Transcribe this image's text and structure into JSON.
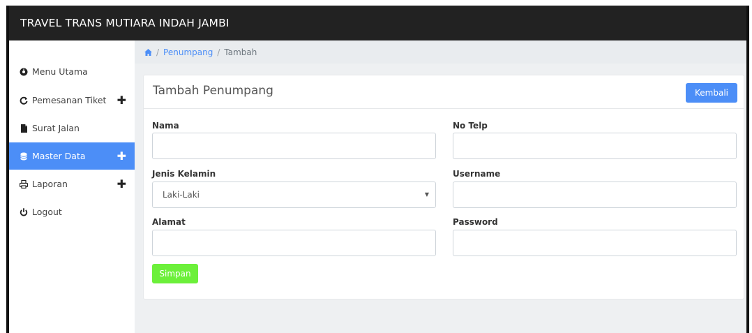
{
  "app": {
    "title": "TRAVEL TRANS MUTIARA INDAH JAMBI"
  },
  "sidebar": {
    "items": [
      {
        "label": "Menu Utama",
        "icon": "dashboard-icon",
        "expandable": false,
        "active": false
      },
      {
        "label": "Pemesanan Tiket",
        "icon": "refresh-icon",
        "expandable": true,
        "active": false
      },
      {
        "label": "Surat Jalan",
        "icon": "file-icon",
        "expandable": false,
        "active": false
      },
      {
        "label": "Master Data",
        "icon": "database-icon",
        "expandable": true,
        "active": true
      },
      {
        "label": "Laporan",
        "icon": "print-icon",
        "expandable": true,
        "active": false
      },
      {
        "label": "Logout",
        "icon": "power-icon",
        "expandable": false,
        "active": false
      }
    ]
  },
  "breadcrumb": {
    "home_icon": "home-icon",
    "items": [
      "Penumpang",
      "Tambah"
    ]
  },
  "card": {
    "title": "Tambah Penumpang",
    "back_label": "Kembali",
    "save_label": "Simpan"
  },
  "form": {
    "nama": {
      "label": "Nama",
      "value": ""
    },
    "no_telp": {
      "label": "No Telp",
      "value": ""
    },
    "jenis_kelamin": {
      "label": "Jenis Kelamin",
      "selected": "Laki-Laki"
    },
    "username": {
      "label": "Username",
      "value": ""
    },
    "alamat": {
      "label": "Alamat",
      "value": ""
    },
    "password": {
      "label": "Password",
      "value": ""
    }
  },
  "colors": {
    "topbar": "#222222",
    "accent": "#4c8ef7",
    "save": "#6cf03a",
    "main_bg": "#eef0f2"
  }
}
